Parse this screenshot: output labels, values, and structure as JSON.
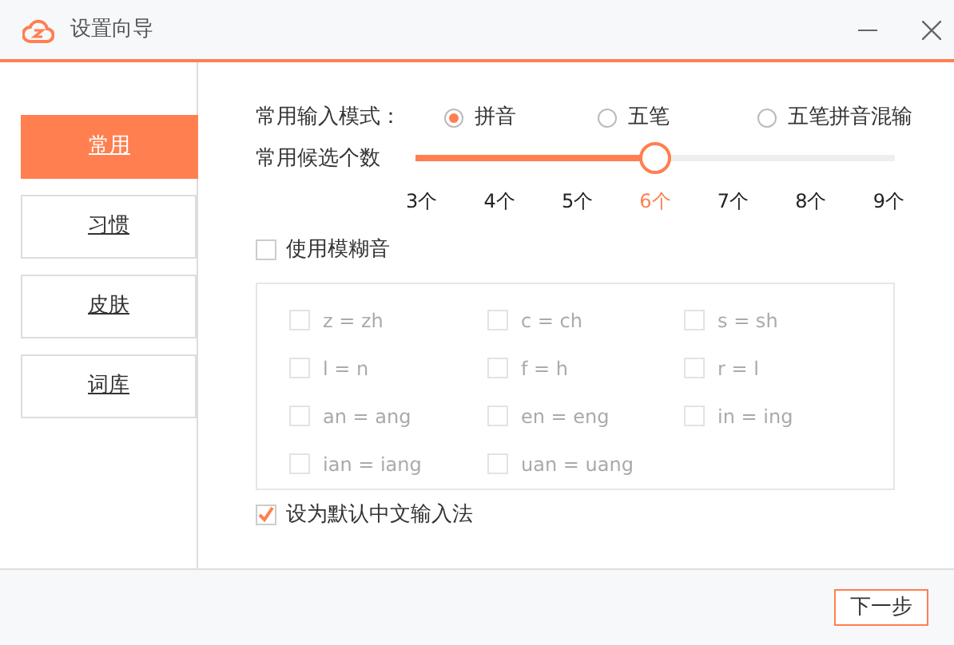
{
  "window": {
    "title": "设置向导"
  },
  "sidebar": {
    "items": [
      {
        "label": "常用",
        "selected": true
      },
      {
        "label": "习惯",
        "selected": false
      },
      {
        "label": "皮肤",
        "selected": false
      },
      {
        "label": "词库",
        "selected": false
      }
    ]
  },
  "input_mode": {
    "label": "常用输入模式：",
    "options": [
      {
        "label": "拼音",
        "selected": true
      },
      {
        "label": "五笔",
        "selected": false
      },
      {
        "label": "五笔拼音混输",
        "selected": false
      }
    ]
  },
  "candidates": {
    "label": "常用候选个数",
    "level": 0.5,
    "ticks": [
      {
        "label": "3个",
        "selected": false
      },
      {
        "label": "4个",
        "selected": false
      },
      {
        "label": "5个",
        "selected": false
      },
      {
        "label": "6个",
        "selected": true
      },
      {
        "label": "7个",
        "selected": false
      },
      {
        "label": "8个",
        "selected": false
      },
      {
        "label": "9个",
        "selected": false
      }
    ]
  },
  "fuzzy": {
    "label": "使用模糊音",
    "checked": false,
    "options": [
      {
        "label": "z = zh",
        "checked": false,
        "disabled": true
      },
      {
        "label": "c = ch",
        "checked": false,
        "disabled": true
      },
      {
        "label": "s = sh",
        "checked": false,
        "disabled": true
      },
      {
        "label": "l = n",
        "checked": false,
        "disabled": true
      },
      {
        "label": "f = h",
        "checked": false,
        "disabled": true
      },
      {
        "label": "r = l",
        "checked": false,
        "disabled": true
      },
      {
        "label": "an = ang",
        "checked": false,
        "disabled": true
      },
      {
        "label": "en = eng",
        "checked": false,
        "disabled": true
      },
      {
        "label": "in = ing",
        "checked": false,
        "disabled": true
      },
      {
        "label": "ian = iang",
        "checked": false,
        "disabled": true
      },
      {
        "label": "uan = uang",
        "checked": false,
        "disabled": true
      }
    ]
  },
  "default_ime": {
    "label": "设为默认中文输入法",
    "checked": true
  },
  "footer": {
    "next_button": "下一步"
  }
}
